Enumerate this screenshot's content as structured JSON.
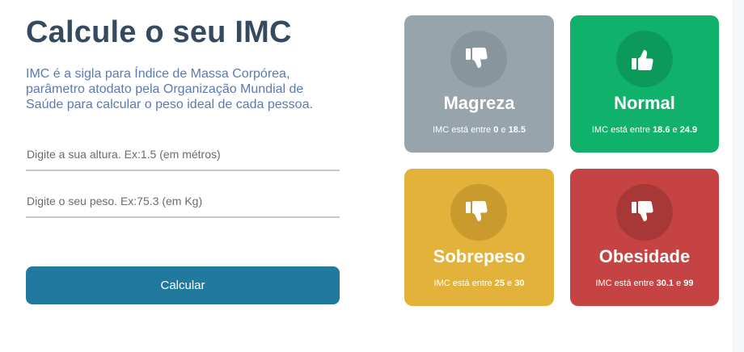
{
  "header": {
    "title": "Calcule o seu IMC",
    "description": "IMC é a sigla para Índice de Massa Corpórea, parâmetro atodato pela Organização Mundial de Saúde para calcular o peso ideal de cada pessoa."
  },
  "form": {
    "height_placeholder": "Digite a sua altura. Ex:1.5 (em métros)",
    "height_value": "",
    "weight_placeholder": "Digite o seu peso. Ex:75.3 (em Kg)",
    "weight_value": "",
    "submit_label": "Calcular"
  },
  "cards": [
    {
      "label": "Magreza",
      "prefix": "IMC está entre ",
      "min": "0",
      "joiner": " e ",
      "max": "18.5",
      "icon": "thumbs-down-icon",
      "color": "#97a4ac"
    },
    {
      "label": "Normal",
      "prefix": "IMC está entre ",
      "min": "18.6",
      "joiner": " e ",
      "max": "24.9",
      "icon": "thumbs-up-icon",
      "color": "#10b26b"
    },
    {
      "label": "Sobrepeso",
      "prefix": "IMC está entre ",
      "min": "25",
      "joiner": " e ",
      "max": "30",
      "icon": "thumbs-down-icon",
      "color": "#e3b23a"
    },
    {
      "label": "Obesidade",
      "prefix": "IMC está entre ",
      "min": "30.1",
      "joiner": " e ",
      "max": "99",
      "icon": "thumbs-down-icon",
      "color": "#c54343"
    }
  ]
}
